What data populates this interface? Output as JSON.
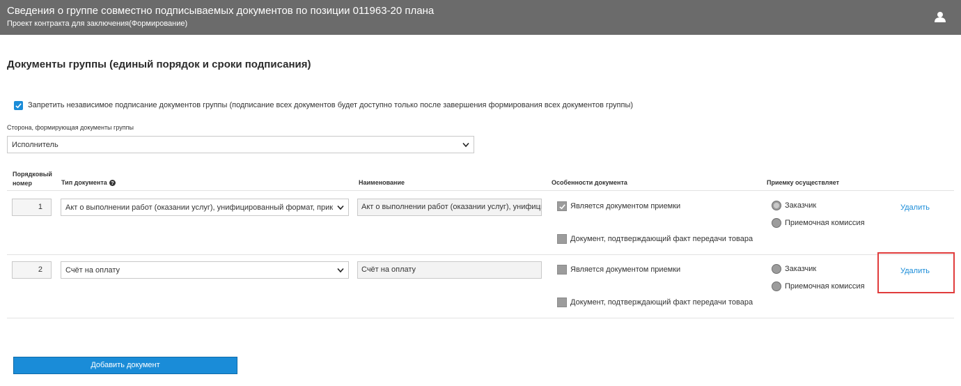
{
  "header": {
    "title": "Сведения о группе совместно подписываемых документов по позиции 011963-20 плана",
    "subtitle": "Проект контракта для заключения(Формирование)"
  },
  "section_title": "Документы группы (единый порядок и сроки подписания)",
  "forbid_independent": {
    "checked": true,
    "label": "Запретить независимое подписание документов группы (подписание всех документов будет доступно только после завершения формирования всех документов группы)"
  },
  "forming_side": {
    "label": "Сторона, формирующая документы группы",
    "value": "Исполнитель"
  },
  "table": {
    "columns": {
      "number_line1": "Порядковый",
      "number_line2": "номер",
      "type": "Тип документа",
      "name": "Наименование",
      "features": "Особенности документа",
      "acceptance": "Приемку осуществляет"
    },
    "rows": [
      {
        "number": "1",
        "type": "Акт о выполнении работ (оказании услуг), унифицированный формат, приказ Ф",
        "name": "Акт о выполнении работ (оказании услуг), унифицир",
        "feature_acceptance": "Является документом приемки",
        "feature_acceptance_checked": true,
        "feature_transfer": "Документ, подтверждающий факт передачи товара",
        "feature_transfer_checked": false,
        "acceptor_customer": "Заказчик",
        "acceptor_commission": "Приемочная комиссия",
        "acceptor_selected": "customer",
        "delete": "Удалить"
      },
      {
        "number": "2",
        "type": "Счёт на оплату",
        "name": "Счёт на оплату",
        "feature_acceptance": "Является документом приемки",
        "feature_acceptance_checked": false,
        "feature_transfer": "Документ, подтверждающий факт передачи товара",
        "feature_transfer_checked": false,
        "acceptor_customer": "Заказчик",
        "acceptor_commission": "Приемочная комиссия",
        "acceptor_selected": "none",
        "delete": "Удалить"
      }
    ]
  },
  "add_button": "Добавить документ",
  "colors": {
    "header_bg": "#6b6b6b",
    "accent": "#1a8cd8",
    "highlight": "#e03b3b"
  }
}
